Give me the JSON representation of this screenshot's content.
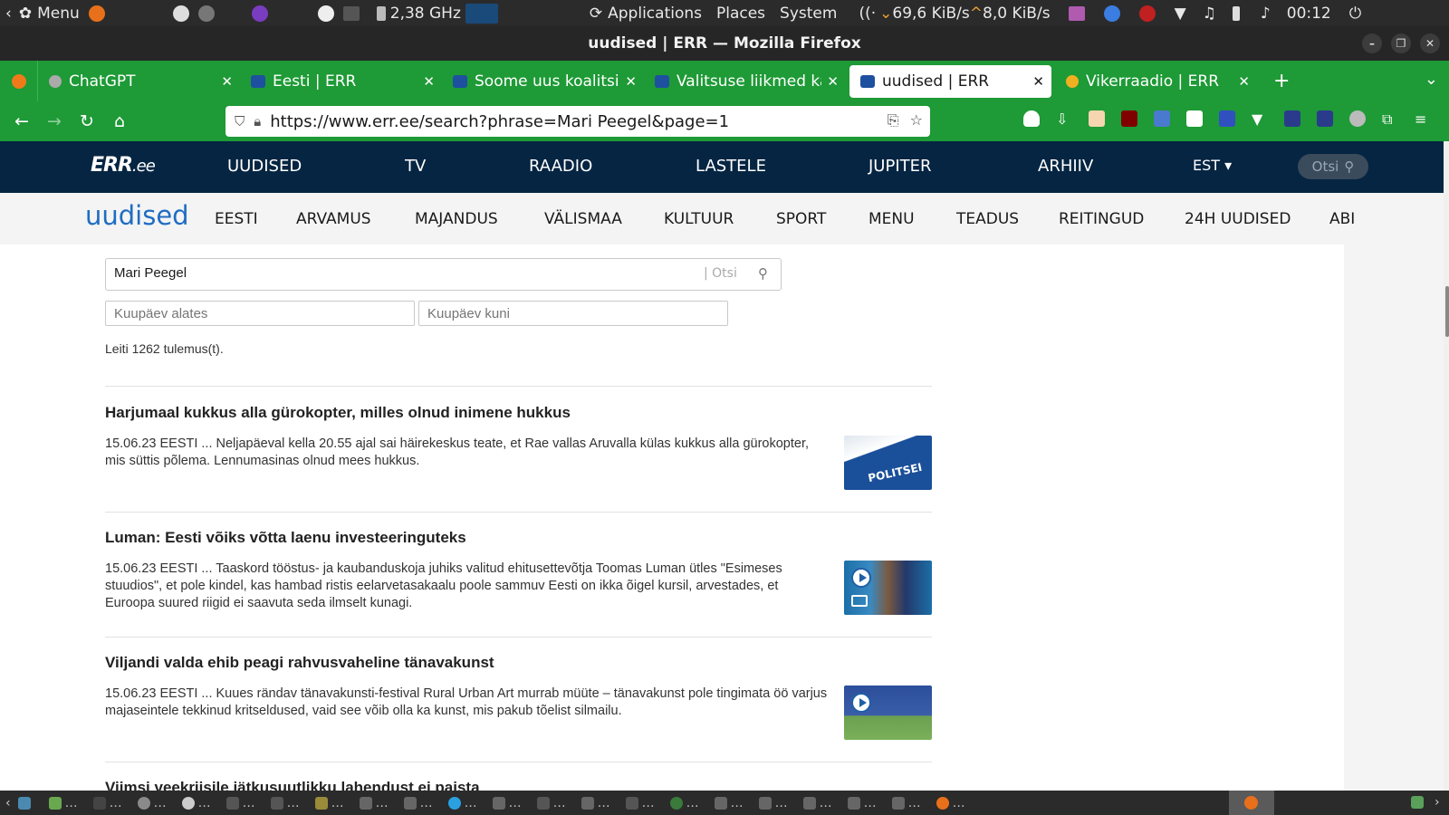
{
  "system_panel": {
    "menu_label": "Menu",
    "cpu_freq": "2,38 GHz",
    "applications": "Applications",
    "places": "Places",
    "system": "System",
    "net_down": "69,6 KiB/s",
    "net_up": "8,0 KiB/s",
    "clock": "00:12"
  },
  "window": {
    "title": "uudised | ERR — Mozilla Firefox"
  },
  "tabs": [
    {
      "label": "ChatGPT",
      "active": false
    },
    {
      "label": "Eesti | ERR",
      "active": false
    },
    {
      "label": "Soome uus koalitsio",
      "active": false
    },
    {
      "label": "Valitsuse liikmed kä",
      "active": false
    },
    {
      "label": "uudised | ERR",
      "active": true
    },
    {
      "label": "Vikerraadio | ERR",
      "active": false
    }
  ],
  "url": "https://www.err.ee/search?phrase=Mari Peegel&page=1",
  "err_header": {
    "logo_main": "ERR",
    "logo_suffix": ".ee",
    "nav": [
      "UUDISED",
      "TV",
      "RAADIO",
      "LASTELE",
      "JUPITER",
      "ARHIIV"
    ],
    "lang": "EST ▾",
    "search_placeholder": "Otsi"
  },
  "sub_header": {
    "brand": "uudised",
    "nav": [
      "EESTI",
      "ARVAMUS",
      "MAJANDUS",
      "VÄLISMAA",
      "KULTUUR",
      "SPORT",
      "MENU",
      "TEADUS",
      "REITINGUD",
      "24H UUDISED",
      "ABI"
    ]
  },
  "search": {
    "query": "Mari Peegel",
    "otsi_hint": "| Otsi",
    "date_from_placeholder": "Kuupäev alates",
    "date_to_placeholder": "Kuupäev kuni",
    "results_count": "Leiti 1262 tulemus(t)."
  },
  "results": [
    {
      "title": "Harjumaal kukkus alla gürokopter, milles olnud inimene hukkus",
      "snippet": "15.06.23 EESTI ... Neljapäeval kella 20.55 ajal sai häirekeskus teate, et Rae vallas Aruvalla külas kukkus alla gürokopter, mis süttis põlema. Lennumasinas olnud mees hukkus.",
      "thumb_text": "POLITSEI"
    },
    {
      "title": "Luman: Eesti võiks võtta laenu investeeringuteks",
      "snippet": "15.06.23 EESTI ... Taaskord tööstus- ja kaubanduskoja juhiks valitud ehitusettevõtja Toomas Luman ütles \"Esimeses stuudios\", et pole kindel, kas hambad ristis eelarvetasakaalu poole sammuv Eesti on ikka õigel kursil, arvestades, et Euroopa suured riigid ei saavuta seda ilmselt kunagi.",
      "thumb_text": ""
    },
    {
      "title": "Viljandi valda ehib peagi rahvusvaheline tänavakunst",
      "snippet": "15.06.23 EESTI ... Kuues rändav tänavakunsti-festival Rural Urban Art murrab müüte – tänavakunst pole tingimata öö varjus majaseintele tekkinud kritseldused, vaid see võib olla ka kunst, mis pakub tõelist silmailu.",
      "thumb_text": ""
    },
    {
      "title": "Viimsi veekriisile jätkusuutlikku lahendust ei paista",
      "snippet": "",
      "thumb_text": ""
    }
  ],
  "colors": {
    "firefox_green": "#1e9a36",
    "err_navy": "#062542",
    "brand_blue": "#1f6dc2"
  }
}
